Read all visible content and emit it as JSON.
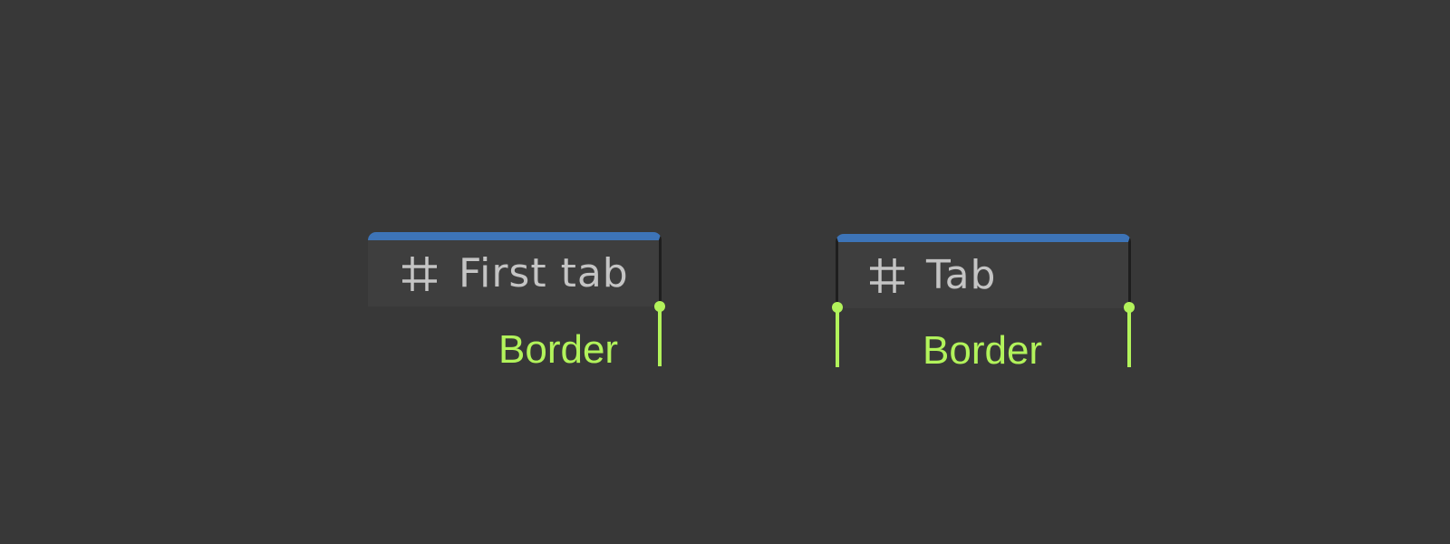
{
  "colors": {
    "background": "#383838",
    "tab_background": "#3e3e3e",
    "tab_accent": "#3d74b8",
    "tab_border": "#1e1e1e",
    "tab_text": "#c4c4c4",
    "annotation": "#b2f35b"
  },
  "tabs": [
    {
      "label": "First tab",
      "icon": "grid-icon"
    },
    {
      "label": "Tab",
      "icon": "grid-icon"
    }
  ],
  "annotations": [
    {
      "label": "Border"
    },
    {
      "label": "Border"
    }
  ]
}
